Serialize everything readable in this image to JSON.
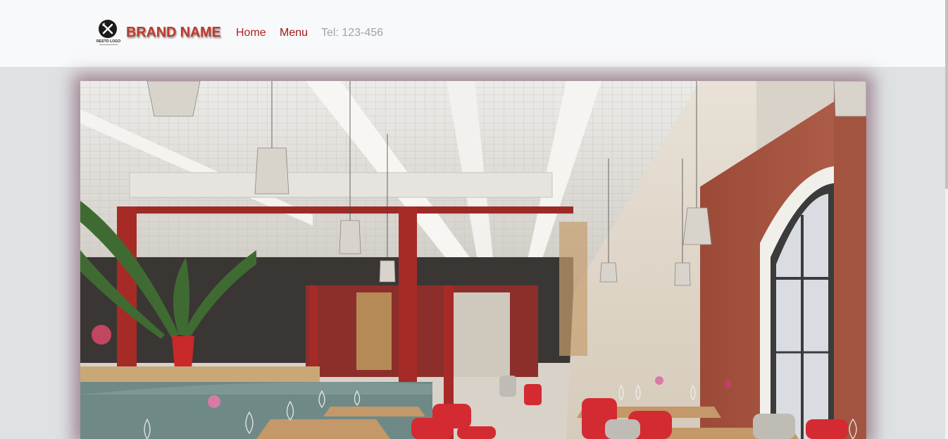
{
  "navbar": {
    "logo_text": "RESTO LOGO",
    "brand": "BRAND NAME",
    "items": [
      {
        "label": "Home"
      },
      {
        "label": "Menu"
      }
    ],
    "phone": "Tel: 123-456"
  },
  "hero": {
    "image": "restaurant-interior-photo"
  },
  "colors": {
    "brand": "#c0392b",
    "nav_link": "#b22222",
    "muted": "#a3a3a3",
    "navbar_bg": "#f8f9fa",
    "page_bg": "#dfe2e5"
  }
}
